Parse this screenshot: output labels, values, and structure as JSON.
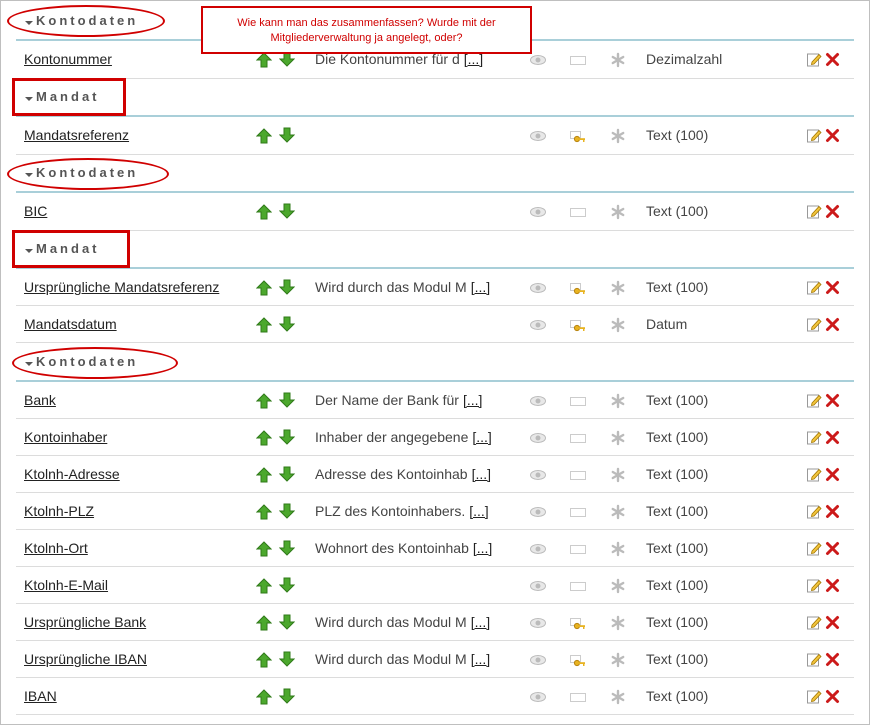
{
  "annotation_note": "Wie kann man das zusammenfassen? Wurde mit der Mitgliederverwaltung ja angelegt, oder?",
  "more_link": "[...]",
  "colors": {
    "annotation": "#d00000",
    "arrow": "#4ca82d",
    "delete": "#cc1a1a",
    "section_line": "#a9cfd9"
  },
  "icons": {
    "move_up": "arrow-up-icon",
    "move_down": "arrow-down-icon",
    "visible": "eye-icon",
    "field": "input-field-icon",
    "key": "key-icon",
    "required": "asterisk-icon",
    "edit": "pencil-icon",
    "delete": "delete-x-icon"
  },
  "rows": [
    {
      "kind": "section",
      "title": "Kontodaten",
      "mark": "ellipse"
    },
    {
      "kind": "field",
      "name": "Kontonummer",
      "desc": "Die Kontonummer für d",
      "key": false,
      "type": "Dezimalzahl"
    },
    {
      "kind": "section",
      "title": "Mandat",
      "mark": "rect"
    },
    {
      "kind": "field",
      "name": "Mandatsreferenz",
      "desc": "",
      "key": true,
      "type": "Text (100)"
    },
    {
      "kind": "section",
      "title": "Kontodaten",
      "mark": "ellipse"
    },
    {
      "kind": "field",
      "name": "BIC",
      "desc": "",
      "key": false,
      "type": "Text (100)"
    },
    {
      "kind": "section",
      "title": "Mandat",
      "mark": "rect"
    },
    {
      "kind": "field",
      "name": "Ursprüngliche Mandatsreferenz",
      "desc": "Wird durch das Modul M",
      "key": true,
      "type": "Text (100)"
    },
    {
      "kind": "field",
      "name": "Mandatsdatum",
      "desc": "",
      "key": true,
      "type": "Datum"
    },
    {
      "kind": "section",
      "title": "Kontodaten",
      "mark": "ellipse"
    },
    {
      "kind": "field",
      "name": "Bank",
      "desc": "Der Name der Bank für",
      "key": false,
      "type": "Text (100)"
    },
    {
      "kind": "field",
      "name": "Kontoinhaber",
      "desc": "Inhaber der angegebene",
      "key": false,
      "type": "Text (100)"
    },
    {
      "kind": "field",
      "name": "Ktolnh-Adresse",
      "desc": "Adresse des Kontoinhab",
      "key": false,
      "type": "Text (100)"
    },
    {
      "kind": "field",
      "name": "Ktolnh-PLZ",
      "desc": "PLZ des Kontoinhabers.",
      "key": false,
      "type": "Text (100)"
    },
    {
      "kind": "field",
      "name": "Ktolnh-Ort",
      "desc": "Wohnort des Kontoinhab",
      "key": false,
      "type": "Text (100)"
    },
    {
      "kind": "field",
      "name": "Ktolnh-E-Mail",
      "desc": "",
      "key": false,
      "type": "Text (100)"
    },
    {
      "kind": "field",
      "name": "Ursprüngliche Bank",
      "desc": "Wird durch das Modul M",
      "key": true,
      "type": "Text (100)"
    },
    {
      "kind": "field",
      "name": "Ursprüngliche IBAN",
      "desc": "Wird durch das Modul M",
      "key": true,
      "type": "Text (100)"
    },
    {
      "kind": "field",
      "name": "IBAN",
      "desc": "",
      "key": false,
      "type": "Text (100)"
    }
  ]
}
